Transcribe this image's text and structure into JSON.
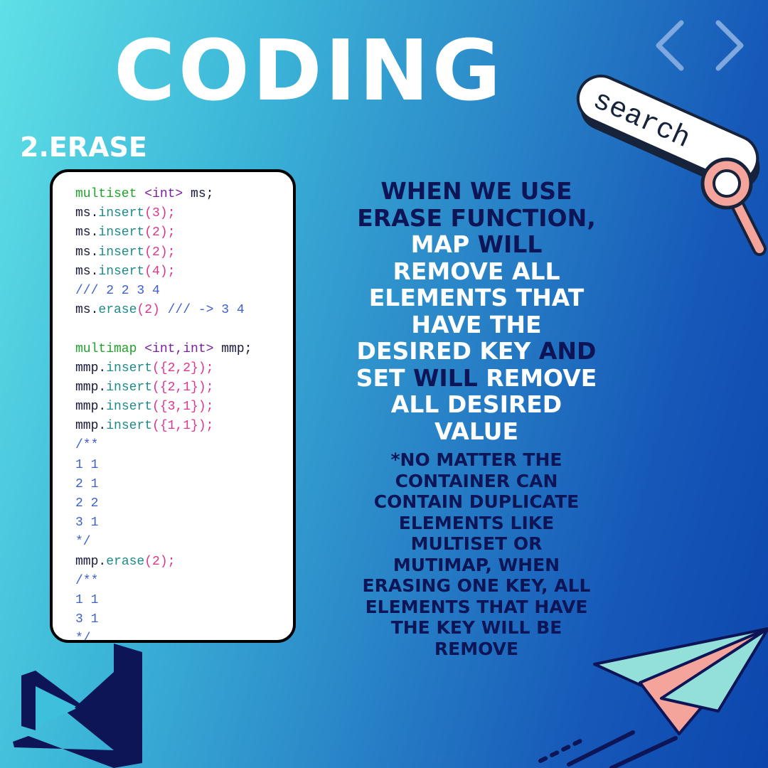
{
  "header": {
    "title": "CODING",
    "subtitle": "2.ERASE"
  },
  "decor": {
    "search_label": "search",
    "icons": [
      "chevron-left-icon",
      "chevron-right-icon",
      "search-bar-illustration",
      "magnifier-icon",
      "paper-plane-icon",
      "visual-studio-logo"
    ]
  },
  "code_snippet": {
    "lines": [
      [
        {
          "t": "multiset ",
          "c": "kw"
        },
        {
          "t": "<int>",
          "c": "type"
        },
        {
          "t": " ms;",
          "c": "plain"
        }
      ],
      [
        {
          "t": "ms.",
          "c": "plain"
        },
        {
          "t": "insert",
          "c": "fn"
        },
        {
          "t": "(3);",
          "c": "num"
        }
      ],
      [
        {
          "t": "ms.",
          "c": "plain"
        },
        {
          "t": "insert",
          "c": "fn"
        },
        {
          "t": "(2);",
          "c": "num"
        }
      ],
      [
        {
          "t": "ms.",
          "c": "plain"
        },
        {
          "t": "insert",
          "c": "fn"
        },
        {
          "t": "(2);",
          "c": "num"
        }
      ],
      [
        {
          "t": "ms.",
          "c": "plain"
        },
        {
          "t": "insert",
          "c": "fn"
        },
        {
          "t": "(4);",
          "c": "num"
        }
      ],
      [
        {
          "t": "/// 2 2 3 4",
          "c": "cm"
        }
      ],
      [
        {
          "t": "ms.",
          "c": "plain"
        },
        {
          "t": "erase",
          "c": "fn"
        },
        {
          "t": "(2)",
          "c": "num"
        },
        {
          "t": " /// -> 3 4",
          "c": "cm"
        }
      ],
      [
        {
          "t": "",
          "c": "plain"
        }
      ],
      [
        {
          "t": "multimap ",
          "c": "kw"
        },
        {
          "t": "<int,int>",
          "c": "type"
        },
        {
          "t": " mmp;",
          "c": "plain"
        }
      ],
      [
        {
          "t": "mmp.",
          "c": "plain"
        },
        {
          "t": "insert",
          "c": "fn"
        },
        {
          "t": "({2,2});",
          "c": "num"
        }
      ],
      [
        {
          "t": "mmp.",
          "c": "plain"
        },
        {
          "t": "insert",
          "c": "fn"
        },
        {
          "t": "({2,1});",
          "c": "num"
        }
      ],
      [
        {
          "t": "mmp.",
          "c": "plain"
        },
        {
          "t": "insert",
          "c": "fn"
        },
        {
          "t": "({3,1});",
          "c": "num"
        }
      ],
      [
        {
          "t": "mmp.",
          "c": "plain"
        },
        {
          "t": "insert",
          "c": "fn"
        },
        {
          "t": "({1,1});",
          "c": "num"
        }
      ],
      [
        {
          "t": "/**",
          "c": "cm"
        }
      ],
      [
        {
          "t": "1 1",
          "c": "cm"
        }
      ],
      [
        {
          "t": "2 1",
          "c": "cm"
        }
      ],
      [
        {
          "t": "2 2",
          "c": "cm"
        }
      ],
      [
        {
          "t": "3 1",
          "c": "cm"
        }
      ],
      [
        {
          "t": "*/",
          "c": "cm"
        }
      ],
      [
        {
          "t": "mmp.",
          "c": "plain"
        },
        {
          "t": "erase",
          "c": "fn"
        },
        {
          "t": "(2);",
          "c": "num"
        }
      ],
      [
        {
          "t": "/**",
          "c": "cm"
        }
      ],
      [
        {
          "t": "1 1",
          "c": "cm"
        }
      ],
      [
        {
          "t": "3 1",
          "c": "cm"
        }
      ],
      [
        {
          "t": "*/",
          "c": "cm"
        }
      ]
    ]
  },
  "explanation": {
    "main_lines": [
      [
        {
          "t": "WHEN WE USE",
          "d": true
        }
      ],
      [
        {
          "t": "ERASE FUNCTION,",
          "d": true
        }
      ],
      [
        {
          "t": "MAP ",
          "d": false
        },
        {
          "t": "WILL",
          "d": true
        }
      ],
      [
        {
          "t": "REMOVE ALL",
          "d": false
        }
      ],
      [
        {
          "t": "ELEMENTS THAT",
          "d": false
        }
      ],
      [
        {
          "t": "HAVE THE",
          "d": false
        }
      ],
      [
        {
          "t": "DESIRED KEY ",
          "d": false
        },
        {
          "t": "AND",
          "d": true
        }
      ],
      [
        {
          "t": "SET ",
          "d": false
        },
        {
          "t": "WILL",
          "d": true
        },
        {
          "t": " REMOVE",
          "d": false
        }
      ],
      [
        {
          "t": "ALL DESIRED",
          "d": false
        }
      ],
      [
        {
          "t": "VALUE",
          "d": false
        }
      ]
    ],
    "note_lines": [
      "*NO MATTER THE",
      "CONTAINER CAN",
      "CONTAIN DUPLICATE",
      "ELEMENTS LIKE",
      "MULTISET OR",
      "MUTIMAP, WHEN",
      "ERASING ONE KEY, ALL",
      "ELEMENTS THAT HAVE",
      "THE KEY WILL BE",
      "REMOVE"
    ]
  },
  "colors": {
    "keyword": "#22a02c",
    "type": "#7a1fa2",
    "function": "#1f8a8a",
    "number": "#e0358a",
    "comment": "#3f5fd0",
    "dark_text": "#0d1557",
    "light_text": "#ffffff"
  }
}
